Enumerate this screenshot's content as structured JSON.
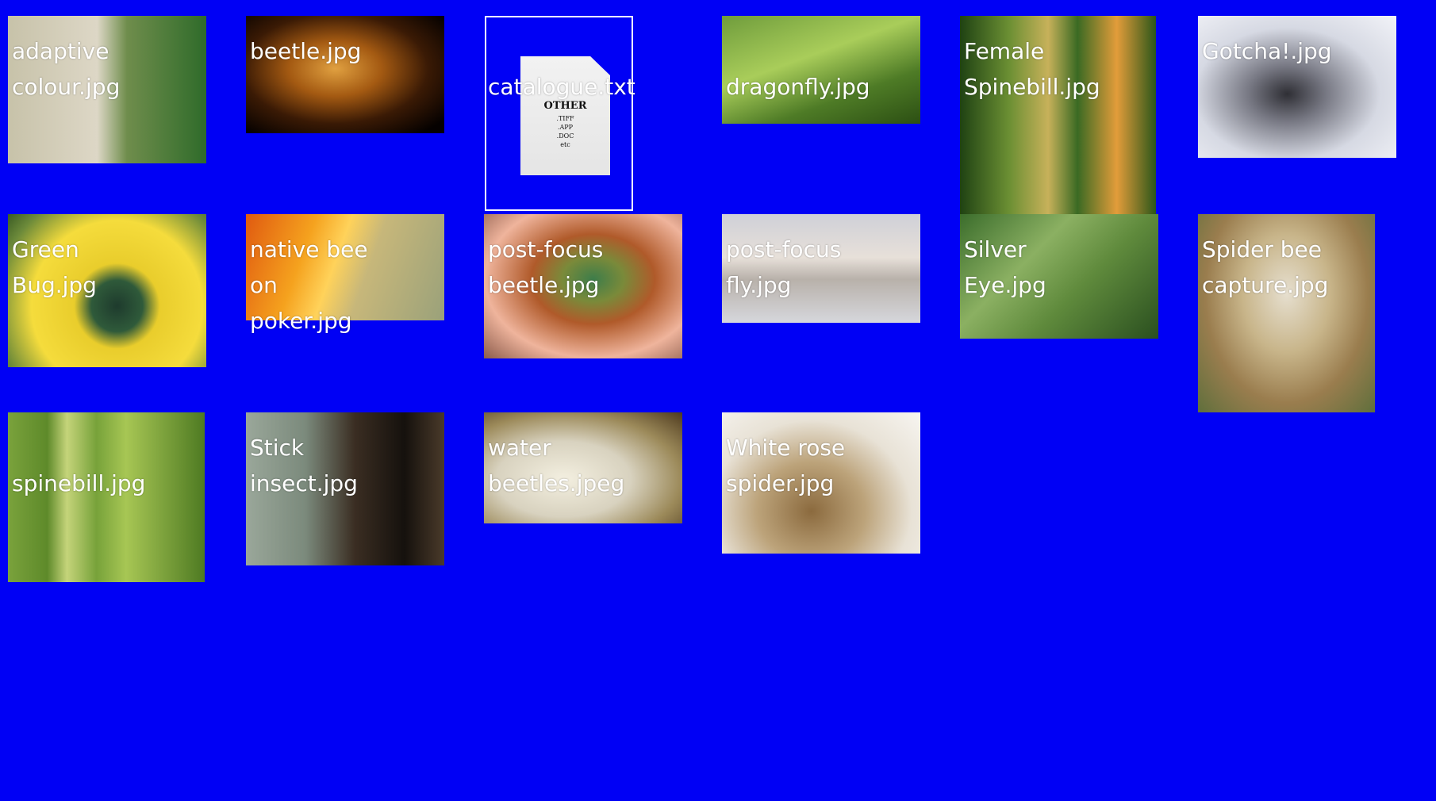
{
  "items": [
    {
      "label": "adaptive colour.jpg"
    },
    {
      "label": "beetle.jpg"
    },
    {
      "label": "catalogue.txt",
      "doc_icon": {
        "title": "OTHER",
        "lines": [
          ".TIFF",
          ".APP",
          ".DOC",
          "etc"
        ]
      }
    },
    {
      "label": "dragonfly.jpg"
    },
    {
      "label": "Female Spinebill.jpg"
    },
    {
      "label": "Gotcha!.jpg"
    },
    {
      "label": "Green Bug.jpg"
    },
    {
      "label": "native bee on poker.jpg"
    },
    {
      "label": "post-focus beetle.jpg"
    },
    {
      "label": "post-focus fly.jpg"
    },
    {
      "label": "Silver Eye.jpg"
    },
    {
      "label": "Spider bee capture.jpg"
    },
    {
      "label": "spinebill.jpg"
    },
    {
      "label": "Stick insect.jpg"
    },
    {
      "label": "water beetles.jpeg"
    },
    {
      "label": "White rose spider.jpg"
    }
  ],
  "colors": {
    "desktop_background": "#0000f5",
    "label_text": "#ffffff"
  }
}
